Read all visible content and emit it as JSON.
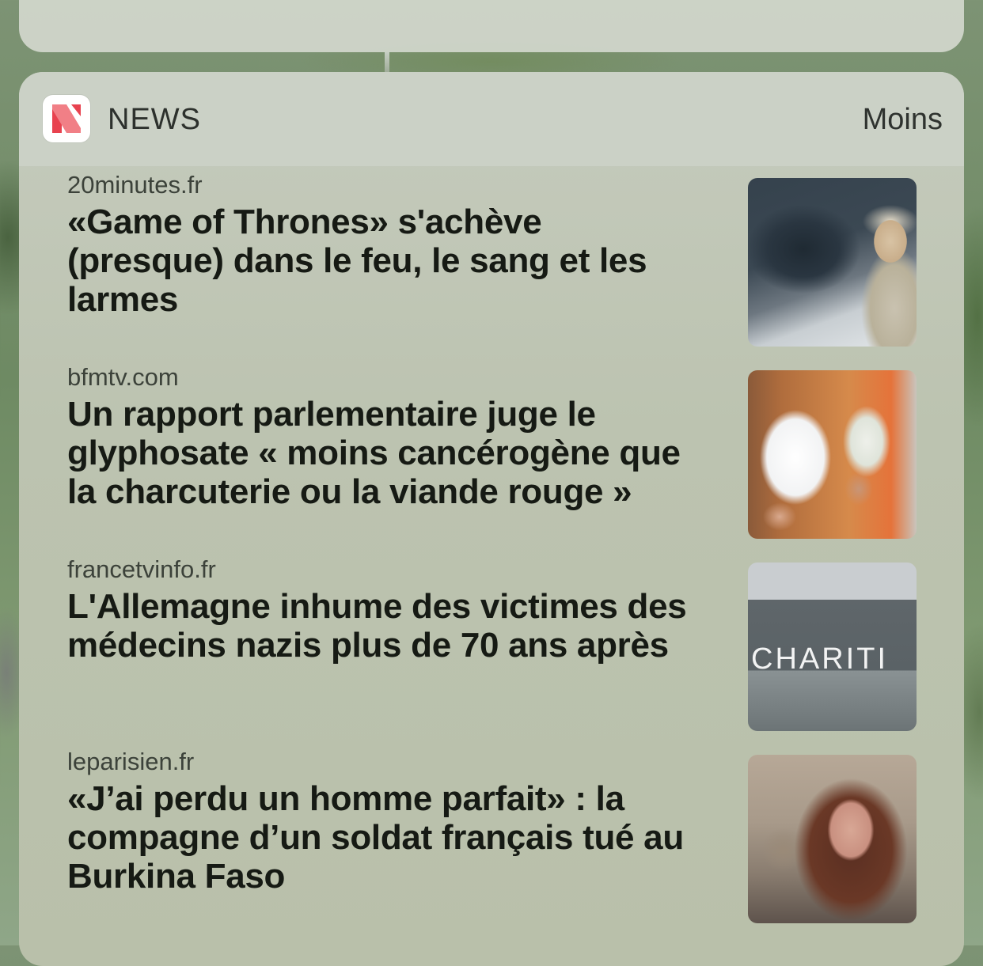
{
  "widget": {
    "app_name": "NEWS",
    "less_label": "Moins"
  },
  "news": [
    {
      "source": "20minutes.fr",
      "headline": "«Game of Thrones» s'achève (presque) dans le feu, le sang et les larmes",
      "thumb_icon": "dragon-photo"
    },
    {
      "source": "bfmtv.com",
      "headline": "Un rapport parlementaire juge le glyphosate « moins cancérogène que la charcuterie ou la viande rouge »",
      "thumb_icon": "roundup-photo"
    },
    {
      "source": "francetvinfo.fr",
      "headline": "L'Allemagne inhume des victimes des médecins nazis plus de 70 ans après",
      "thumb_icon": "charite-building-photo",
      "thumb_text": "CHARITI"
    },
    {
      "source": "leparisien.fr",
      "headline": "«J’ai perdu un homme parfait» : la compagne d’un soldat français tué au Burkina Faso",
      "thumb_icon": "woman-portrait-photo"
    }
  ],
  "colors": {
    "icon_red": "#e8424f",
    "icon_pink": "#f17f86"
  }
}
